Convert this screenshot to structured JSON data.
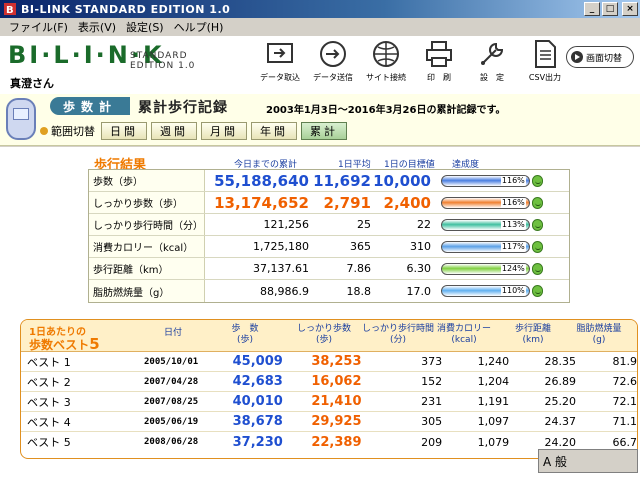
{
  "window": {
    "title": "BI-LINK STANDARD EDITION 1.0",
    "min": "_",
    "max": "□",
    "close": "×"
  },
  "menu": [
    "ファイル(F)",
    "表示(V)",
    "設定(S)",
    "ヘルプ(H)"
  ],
  "header": {
    "logo_main": "BI·L·I·N·K",
    "logo_ed1": "STANDARD",
    "logo_ed2": "EDITION 1.0",
    "user_name": "真澄さん",
    "toolbar": [
      {
        "label": "データ取込",
        "icon": "import-icon"
      },
      {
        "label": "データ送信",
        "icon": "send-icon"
      },
      {
        "label": "サイト接続",
        "icon": "site-icon"
      },
      {
        "label": "印　刷",
        "icon": "printer-icon"
      },
      {
        "label": "設　定",
        "icon": "settings-icon"
      },
      {
        "label": "CSV出力",
        "icon": "csv-icon"
      }
    ],
    "screen_switch": "画面切替"
  },
  "nav": {
    "section": "歩数計",
    "page_title": "累計歩行記録",
    "record_range": "2003年1月3日～2016年3月26日の累計記録です。",
    "range_label": "範囲切替",
    "range_buttons": [
      "日間",
      "週間",
      "月間",
      "年間",
      "累計"
    ],
    "active_range": "累計"
  },
  "results": {
    "title": "歩行結果",
    "col_total": "今日までの累計",
    "col_avg": "1日平均",
    "col_goal": "1日の目標値",
    "col_rate": "達成度",
    "rows": [
      {
        "label": "歩数（歩）",
        "total": "55,188,640",
        "avg": "11,692",
        "goal": "10,000",
        "pct": "116%",
        "rate": 116,
        "style": "big blue",
        "color": "#4a7ee0"
      },
      {
        "label": "しっかり歩数（歩）",
        "total": "13,174,652",
        "avg": "2,791",
        "goal": "2,400",
        "pct": "116%",
        "rate": 116,
        "style": "big orange",
        "color": "#f08030"
      },
      {
        "label": "しっかり歩行時間（分）",
        "total": "121,256",
        "avg": "25",
        "goal": "22",
        "pct": "113%",
        "rate": 113,
        "style": "",
        "color": "#40c0a0"
      },
      {
        "label": "消費カロリー（kcal）",
        "total": "1,725,180",
        "avg": "365",
        "goal": "310",
        "pct": "117%",
        "rate": 117,
        "style": "",
        "color": "#5aa0e8"
      },
      {
        "label": "歩行距離（km）",
        "total": "37,137.61",
        "avg": "7.86",
        "goal": "6.30",
        "pct": "124%",
        "rate": 124,
        "style": "",
        "color": "#80d040"
      },
      {
        "label": "脂肪燃焼量（g）",
        "total": "88,986.9",
        "avg": "18.8",
        "goal": "17.0",
        "pct": "110%",
        "rate": 110,
        "style": "",
        "color": "#60b0f0"
      }
    ]
  },
  "best": {
    "title_line1": "1日あたりの",
    "title_line2": "歩数ベスト",
    "title_num": "5",
    "headers": {
      "date": "日付",
      "steps": "歩　数\n(歩)",
      "firm_steps": "しっかり歩数\n(歩)",
      "firm_time": "しっかり歩行時間\n(分)",
      "calories": "消費カロリー\n(kcal)",
      "distance": "歩行距離\n(km)",
      "fat": "脂肪燃焼量\n(g)"
    },
    "rows": [
      {
        "rank": "ベスト 1",
        "date": "2005/10/01",
        "steps": "45,009",
        "firm": "38,253",
        "time": "373",
        "kcal": "1,240",
        "km": "28.35",
        "fat": "81.9"
      },
      {
        "rank": "ベスト 2",
        "date": "2007/04/28",
        "steps": "42,683",
        "firm": "16,062",
        "time": "152",
        "kcal": "1,204",
        "km": "26.89",
        "fat": "72.6"
      },
      {
        "rank": "ベスト 3",
        "date": "2007/08/25",
        "steps": "40,010",
        "firm": "21,410",
        "time": "231",
        "kcal": "1,191",
        "km": "25.20",
        "fat": "72.1"
      },
      {
        "rank": "ベスト 4",
        "date": "2005/06/19",
        "steps": "38,678",
        "firm": "29,925",
        "time": "305",
        "kcal": "1,097",
        "km": "24.37",
        "fat": "71.1"
      },
      {
        "rank": "ベスト 5",
        "date": "2008/06/28",
        "steps": "37,230",
        "firm": "22,389",
        "time": "209",
        "kcal": "1,079",
        "km": "24.20",
        "fat": "66.7"
      }
    ]
  },
  "status": {
    "ime": "A 般"
  }
}
